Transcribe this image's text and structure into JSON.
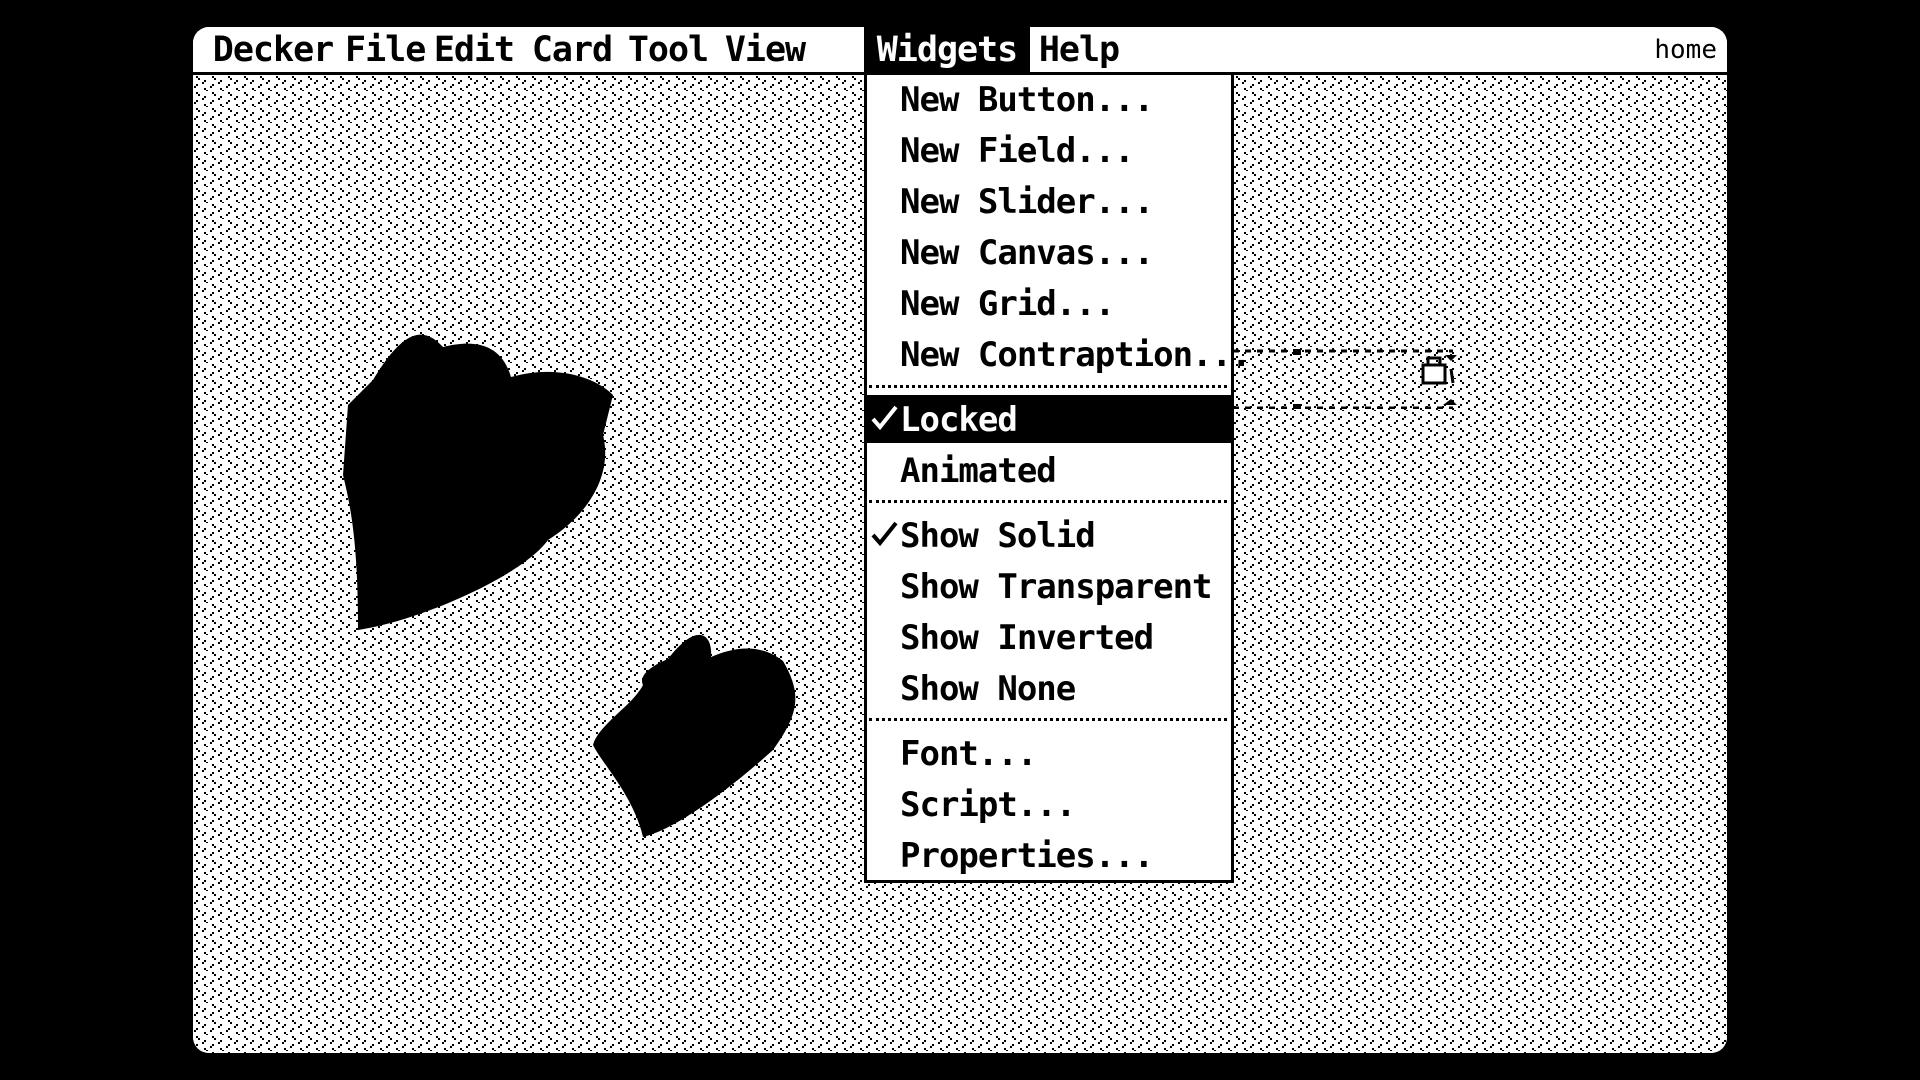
{
  "menubar": {
    "titles": [
      "Decker",
      "File",
      "Edit",
      "Card",
      "Tool",
      "View",
      "Widgets",
      "Help"
    ],
    "active": "Widgets",
    "card_name": "home"
  },
  "widgets_menu": {
    "items": [
      "New Button...",
      "New Field...",
      "New Slider...",
      "New Canvas...",
      "New Grid...",
      "New Contraption...",
      "Locked",
      "Animated",
      "Show Solid",
      "Show Transparent",
      "Show Inverted",
      "Show None",
      "Font...",
      "Script...",
      "Properties..."
    ],
    "checked": [
      "Locked",
      "Show Solid"
    ],
    "highlighted": "Locked"
  },
  "canvas": {
    "fill_pattern": "diagonal-dash-pattern",
    "shapes": [
      "heart",
      "heart"
    ]
  },
  "icons": {
    "check": "check-icon",
    "lock": "lock-icon"
  },
  "colors": {
    "background": "#000000",
    "screen": "#ffffff",
    "ink": "#000000"
  }
}
